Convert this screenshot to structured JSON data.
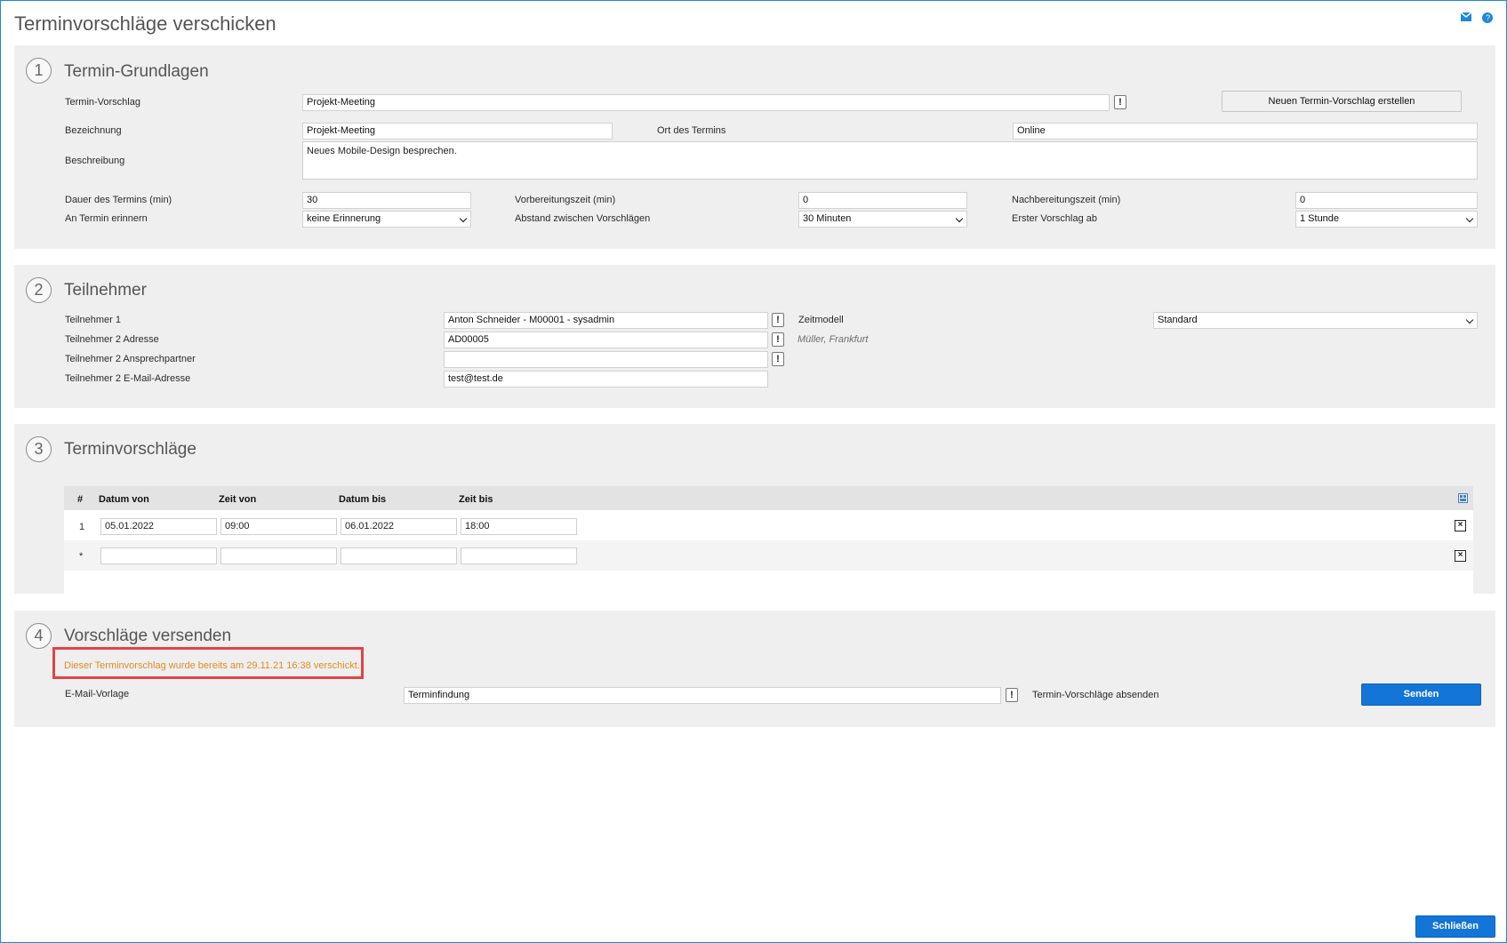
{
  "window": {
    "title": "Terminvorschläge verschicken",
    "icons": [
      "mail-icon",
      "help-icon"
    ]
  },
  "sections": {
    "grundlagen": {
      "number": "1",
      "title": "Termin-Grundlagen",
      "labels": {
        "termin_vorschlag": "Termin-Vorschlag",
        "bezeichnung": "Bezeichnung",
        "ort": "Ort des Termins",
        "beschreibung": "Beschreibung",
        "dauer": "Dauer des Termins (min)",
        "vorbereitung": "Vorbereitungszeit (min)",
        "nachbereitung": "Nachbereitungszeit (min)",
        "erinnern": "An Termin erinnern",
        "abstand": "Abstand zwischen Vorschlägen",
        "erster": "Erster Vorschlag ab"
      },
      "values": {
        "termin_vorschlag": "Projekt-Meeting",
        "bezeichnung": "Projekt-Meeting",
        "ort": "Online",
        "beschreibung": "Neues Mobile-Design besprechen.",
        "dauer": "30",
        "vorbereitung": "0",
        "nachbereitung": "0",
        "erinnern": "keine Erinnerung",
        "abstand": "30 Minuten",
        "erster": "1 Stunde"
      },
      "button": "Neuen Termin-Vorschlag erstellen"
    },
    "teilnehmer": {
      "number": "2",
      "title": "Teilnehmer",
      "labels": {
        "t1": "Teilnehmer 1",
        "t2_adresse": "Teilnehmer 2 Adresse",
        "t2_ansprech": "Teilnehmer 2 Ansprechpartner",
        "t2_email": "Teilnehmer 2 E-Mail-Adresse",
        "zeitmodell": "Zeitmodell"
      },
      "values": {
        "t1": "Anton Schneider - M00001 - sysadmin",
        "t2_adresse": "AD00005",
        "t2_ansprech": "",
        "t2_email": "test@test.de",
        "zeitmodell": "Standard",
        "address_hint": "Müller, Frankfurt"
      }
    },
    "vorschlaege": {
      "number": "3",
      "title": "Terminvorschläge",
      "columns": [
        "#",
        "Datum von",
        "Zeit von",
        "Datum bis",
        "Zeit bis"
      ],
      "rows": [
        [
          "1",
          "05.01.2022",
          "09:00",
          "06.01.2022",
          "18:00"
        ],
        [
          "*",
          "",
          "",
          "",
          ""
        ]
      ]
    },
    "versenden": {
      "number": "4",
      "title": "Vorschläge versenden",
      "notice": "Dieser Terminvorschlag wurde bereits am 29.11.21 16:38 verschickt.",
      "email_label": "E-Mail-Vorlage",
      "email_value": "Terminfindung",
      "send_label": "Termin-Vorschläge absenden",
      "send_button": "Senden"
    }
  },
  "footer": {
    "close_button": "Schließen"
  },
  "colors": {
    "accent": "#1475d8",
    "notice": "#df8b23",
    "highlight_border": "#e24444",
    "section_bg": "#efefef"
  }
}
